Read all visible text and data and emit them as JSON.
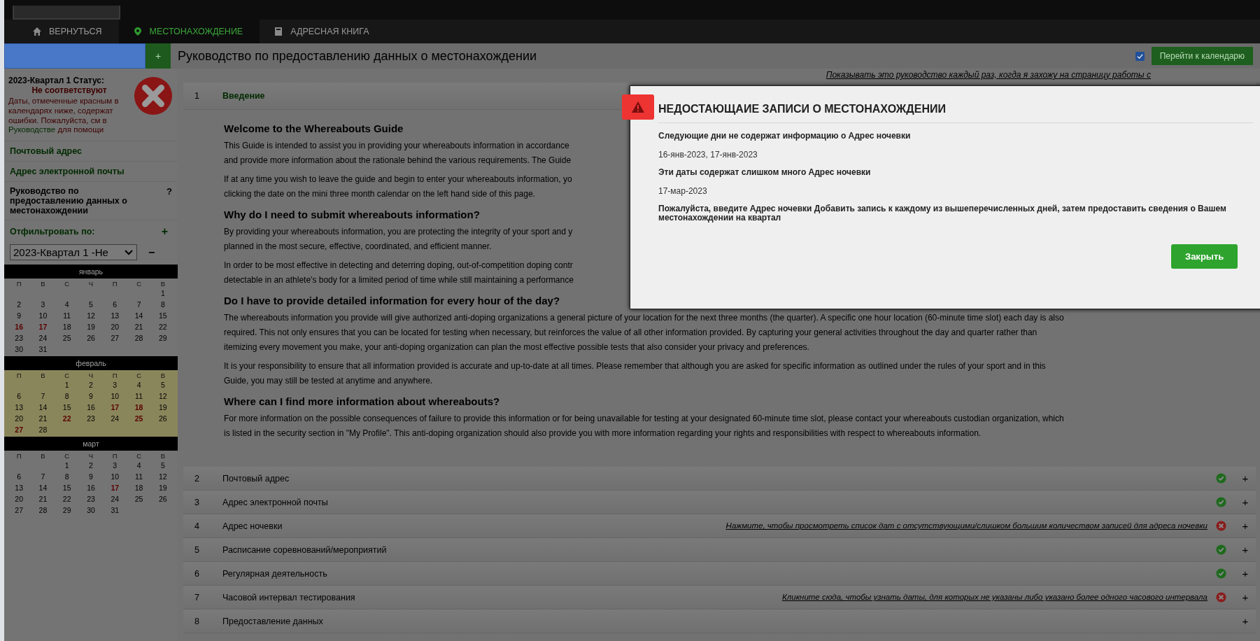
{
  "nav": {
    "tabs": [
      {
        "label": "ВЕРНУТЬСЯ",
        "selected": false
      },
      {
        "label": "МЕСТОНАХОЖДЕНИЕ",
        "selected": true
      },
      {
        "label": "АДРЕСНАЯ КНИГА",
        "selected": false
      }
    ]
  },
  "header": {
    "add": "+",
    "title": "Руководство по предоставлению данных о местонахождении",
    "show_guide_checked": true,
    "calendar_button": "Перейти к календарю",
    "show_guide_link": "Показывать это руководство каждый раз, когда я захожу на страницу работы с"
  },
  "sidebar": {
    "status_label": "2023-Квартал 1 Статус:",
    "status_value": "Не соответствуют",
    "note": "Даты, отмеченные красным в календарях ниже, содержат ошибки. Пожалуйста, см в",
    "note_link": "Руководстве",
    "note_end": "для помощи",
    "links": [
      {
        "label": "Почтовый адрес",
        "kind": "link"
      },
      {
        "label": "Адрес электронной почты",
        "kind": "link"
      },
      {
        "label": "Руководство по предоставлению данных о местонахождении",
        "kind": "current",
        "help": "?"
      }
    ],
    "filter_label": "Отфильтровать по:",
    "filter_add": "+",
    "filter_value": "2023-Квартал 1 -Не",
    "filter_remove": "−",
    "months": [
      {
        "name": "январь",
        "highlighted": false,
        "weekdays": [
          "П",
          "В",
          "С",
          "Ч",
          "П",
          "С",
          "В"
        ],
        "weeks": [
          [
            {
              "d": "1",
              "error": false
            }
          ],
          [
            {
              "d": "2",
              "error": false
            },
            {
              "d": "3",
              "error": false
            },
            {
              "d": "4",
              "error": false
            },
            {
              "d": "5",
              "error": false
            },
            {
              "d": "6",
              "error": false
            },
            {
              "d": "7",
              "error": false
            },
            {
              "d": "8",
              "error": false
            }
          ],
          [
            {
              "d": "9",
              "error": false
            },
            {
              "d": "10",
              "error": false
            },
            {
              "d": "11",
              "error": false
            },
            {
              "d": "12",
              "error": false
            },
            {
              "d": "13",
              "error": false
            },
            {
              "d": "14",
              "error": false
            },
            {
              "d": "15",
              "error": false
            }
          ],
          [
            {
              "d": "16",
              "error": true
            },
            {
              "d": "17",
              "error": true
            },
            {
              "d": "18",
              "error": false
            },
            {
              "d": "19",
              "error": false
            },
            {
              "d": "20",
              "error": false
            },
            {
              "d": "21",
              "error": false
            },
            {
              "d": "22",
              "error": false
            }
          ],
          [
            {
              "d": "23",
              "error": false
            },
            {
              "d": "24",
              "error": false
            },
            {
              "d": "25",
              "error": false
            },
            {
              "d": "26",
              "error": false
            },
            {
              "d": "27",
              "error": false
            },
            {
              "d": "28",
              "error": false
            },
            {
              "d": "29",
              "error": false
            }
          ],
          [
            {
              "d": "30",
              "error": false
            },
            {
              "d": "31",
              "error": false
            }
          ]
        ]
      },
      {
        "name": "февраль",
        "highlighted": true,
        "weekdays": [
          "П",
          "В",
          "С",
          "Ч",
          "П",
          "С",
          "В"
        ],
        "weeks": [
          [
            {
              "d": "1",
              "error": false
            },
            {
              "d": "2",
              "error": false
            },
            {
              "d": "3",
              "error": false
            },
            {
              "d": "4",
              "error": false
            },
            {
              "d": "5",
              "error": false
            }
          ],
          [
            {
              "d": "6",
              "error": false
            },
            {
              "d": "7",
              "error": false
            },
            {
              "d": "8",
              "error": false
            },
            {
              "d": "9",
              "error": false
            },
            {
              "d": "10",
              "error": false
            },
            {
              "d": "11",
              "error": false
            },
            {
              "d": "12",
              "error": false
            }
          ],
          [
            {
              "d": "13",
              "error": false
            },
            {
              "d": "14",
              "error": false
            },
            {
              "d": "15",
              "error": false
            },
            {
              "d": "16",
              "error": false
            },
            {
              "d": "17",
              "error": true
            },
            {
              "d": "18",
              "error": true
            },
            {
              "d": "19",
              "error": false
            }
          ],
          [
            {
              "d": "20",
              "error": false
            },
            {
              "d": "21",
              "error": false
            },
            {
              "d": "22",
              "error": true
            },
            {
              "d": "23",
              "error": false
            },
            {
              "d": "24",
              "error": false
            },
            {
              "d": "25",
              "error": true
            },
            {
              "d": "26",
              "error": false
            }
          ],
          [
            {
              "d": "27",
              "error": true
            },
            {
              "d": "28",
              "error": false
            }
          ]
        ]
      },
      {
        "name": "март",
        "highlighted": false,
        "weekdays": [
          "П",
          "В",
          "С",
          "Ч",
          "П",
          "С",
          "В"
        ],
        "weeks": [
          [
            {
              "d": "1",
              "error": false
            },
            {
              "d": "2",
              "error": false
            },
            {
              "d": "3",
              "error": false
            },
            {
              "d": "4",
              "error": false
            },
            {
              "d": "5",
              "error": false
            }
          ],
          [
            {
              "d": "6",
              "error": false
            },
            {
              "d": "7",
              "error": false
            },
            {
              "d": "8",
              "error": false
            },
            {
              "d": "9",
              "error": false
            },
            {
              "d": "10",
              "error": false
            },
            {
              "d": "11",
              "error": false
            },
            {
              "d": "12",
              "error": false
            }
          ],
          [
            {
              "d": "13",
              "error": false
            },
            {
              "d": "14",
              "error": false
            },
            {
              "d": "15",
              "error": false
            },
            {
              "d": "16",
              "error": false
            },
            {
              "d": "17",
              "error": true
            },
            {
              "d": "18",
              "error": false
            },
            {
              "d": "19",
              "error": false
            }
          ],
          [
            {
              "d": "20",
              "error": false
            },
            {
              "d": "21",
              "error": false
            },
            {
              "d": "22",
              "error": false
            },
            {
              "d": "23",
              "error": false
            },
            {
              "d": "24",
              "error": false
            },
            {
              "d": "25",
              "error": false
            },
            {
              "d": "26",
              "error": false
            }
          ],
          [
            {
              "d": "27",
              "error": false
            },
            {
              "d": "28",
              "error": false
            },
            {
              "d": "29",
              "error": false
            },
            {
              "d": "30",
              "error": false
            },
            {
              "d": "31",
              "error": false
            }
          ]
        ]
      }
    ]
  },
  "sections": [
    {
      "number": "1",
      "title": "Введение",
      "selected": true,
      "kind": "plain"
    },
    {
      "number": "2",
      "title": "Почтовый адрес",
      "selected": false,
      "kind": "ok",
      "add": "+"
    },
    {
      "number": "3",
      "title": "Адрес электронной почты",
      "selected": false,
      "kind": "ok",
      "add": "+"
    },
    {
      "number": "4",
      "title": "Адрес ночевки",
      "selected": false,
      "kind": "error",
      "link": "Нажмите, чтобы просмотреть список дат с отсутствующими/слишком большим количеством записей для адреса ночевки",
      "add": "+"
    },
    {
      "number": "5",
      "title": "Расписание соревнований/мероприятий",
      "selected": false,
      "kind": "ok",
      "add": "+"
    },
    {
      "number": "6",
      "title": "Регулярная деятельность",
      "selected": false,
      "kind": "ok",
      "add": "+"
    },
    {
      "number": "7",
      "title": "Часовой интервал тестирования",
      "selected": false,
      "kind": "error",
      "link": "Кликните сюда, чтобы узнать даты, для которых не указаны либо указано более одного часового интервала",
      "add": "+"
    },
    {
      "number": "8",
      "title": "Предоставление данных",
      "selected": false,
      "kind": "plain",
      "add": "+"
    }
  ],
  "guide": [
    {
      "kind": "heading",
      "lines": [
        "Welcome to the Whereabouts Guide"
      ]
    },
    {
      "kind": "paragraph",
      "lines": [
        "This Guide is intended to assist you in providing your whereabouts information in accordance",
        "and provide more information about the rationale behind the various requirements. The Guide"
      ]
    },
    {
      "kind": "paragraph",
      "lines": [
        "If at any time you wish to leave the guide and begin to enter your whereabouts information, yo",
        "clicking the date on the mini three month calendar on the left hand side of this page."
      ]
    },
    {
      "kind": "heading",
      "lines": [
        "Why do I need to submit whereabouts information?"
      ]
    },
    {
      "kind": "paragraph",
      "lines": [
        "By providing your whereabouts information, you are protecting the integrity of your sport and y",
        "planned in the most secure, effective, coordinated, and efficient manner."
      ]
    },
    {
      "kind": "paragraph",
      "lines": [
        "In order to be most effective in detecting and deterring doping, out-of-competition doping contr",
        "detectable in an athlete's body for a limited period of time while still maintaining a performance"
      ]
    },
    {
      "kind": "heading",
      "lines": [
        "Do I have to provide detailed information for every hour of the day?"
      ]
    },
    {
      "kind": "paragraph",
      "lines": [
        "The whereabouts information you provide will give authorized anti-doping organizations a general picture of your location for the next three months (the quarter). A specific one hour location (60-minute time slot) each day is also",
        "required. This not only ensures that you can be located for testing when necessary, but reinforces the value of all other information provided. By capturing your general activities throughout the day and quarter rather than",
        "itemizing every movement you make, your anti-doping organization can plan the most effective possible tests that also consider your privacy and preferences."
      ]
    },
    {
      "kind": "paragraph",
      "lines": [
        "It is your responsibility to ensure that all information provided is accurate and up-to-date at all times. Please remember that although you are asked for specific information as outlined under the rules of your sport and in this",
        "Guide, you may still be tested at anytime and anywhere."
      ]
    },
    {
      "kind": "heading",
      "lines": [
        "Where can I find more information about whereabouts?"
      ]
    },
    {
      "kind": "paragraph",
      "lines": [
        "For more information on the possible consequences of failure to provide this information or for being unavailable for testing at your designated 60-minute time slot, please contact your whereabouts custodian organization, which",
        "is listed in the security section in \"My Profile\". This anti-doping organization should also provide you with more information regarding your rights and responsibilities with respect to whereabouts information."
      ]
    }
  ],
  "modal": {
    "title": "НЕДОСТАЮЩАИЕ ЗАПИСИ О МЕСТОНАХОЖДЕНИИ",
    "blocks": [
      {
        "kind": "bold",
        "text": "Следующие дни не содержат информацию о Адрес ночевки"
      },
      {
        "kind": "plain",
        "text": "16-янв-2023, 17-янв-2023"
      },
      {
        "kind": "bold",
        "text": "Эти даты содержат слишком много Адрес ночевки"
      },
      {
        "kind": "plain",
        "text": "17-мар-2023"
      },
      {
        "kind": "bold",
        "text": "Пожалуйста, введите Адрес ночевки Добавить запись к каждому из вышеперечисленных дней, затем предоставить сведения о Вашем местонахождении на квартал"
      }
    ],
    "close_button": "Закрыть"
  }
}
